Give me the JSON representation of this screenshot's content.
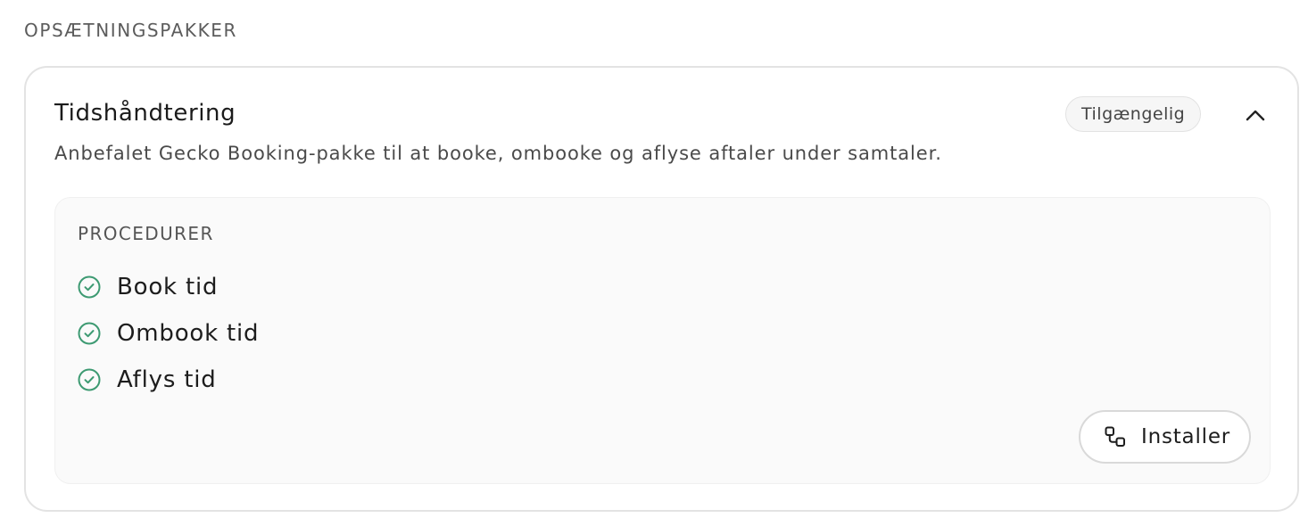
{
  "section": {
    "heading": "OPSÆTNINGSPAKKER"
  },
  "package": {
    "title": "Tidshåndtering",
    "status": "Tilgængelig",
    "description": "Anbefalet Gecko Booking-pakke til at booke, ombooke og aflyse aftaler under samtaler.",
    "toggle_icon": "chevron-up-icon",
    "procedures": {
      "heading": "PROCEDURER",
      "items": [
        {
          "label": "Book tid",
          "icon": "check-circle-icon"
        },
        {
          "label": "Ombook tid",
          "icon": "check-circle-icon"
        },
        {
          "label": "Aflys tid",
          "icon": "check-circle-icon"
        }
      ]
    },
    "install_button": {
      "label": "Installer",
      "icon": "install-icon"
    }
  },
  "colors": {
    "check_green": "#3d9a72",
    "border": "#e3e3e3",
    "panel_background": "#fafafa"
  }
}
